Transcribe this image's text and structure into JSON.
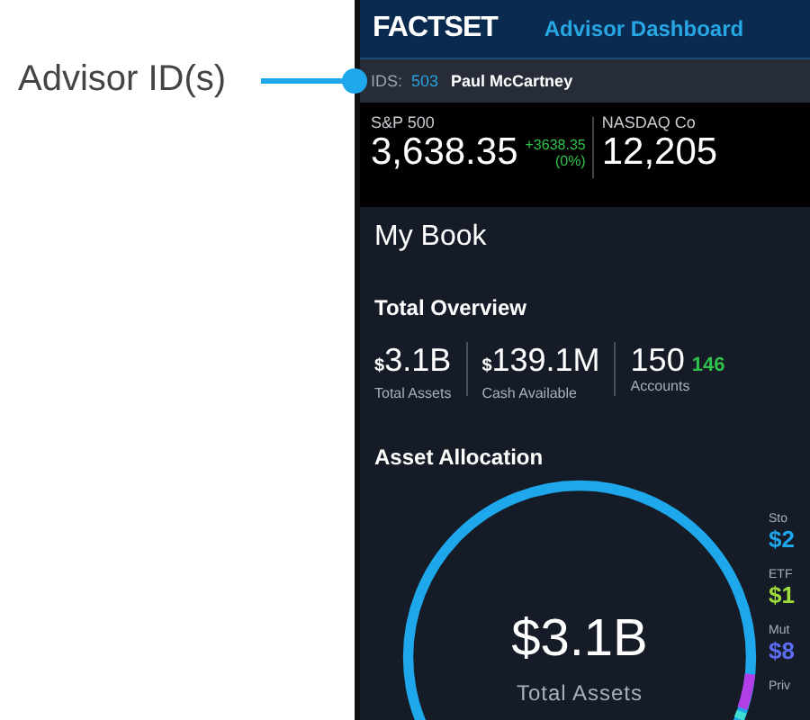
{
  "callout": {
    "label": "Advisor ID(s)"
  },
  "header": {
    "logo": "FACTSET",
    "title": "Advisor Dashboard"
  },
  "id_bar": {
    "prefix": "IDS:",
    "id": "503",
    "name": "Paul McCartney"
  },
  "tickers": [
    {
      "name": "S&P 500",
      "value": "3,638.35",
      "change": "+3638.35",
      "percent": "(0%)"
    },
    {
      "name": "NASDAQ Co",
      "value": "12,205"
    }
  ],
  "book": {
    "title": "My Book",
    "overview_title": "Total Overview",
    "stats": [
      {
        "currency": "$",
        "amount": "3.1B",
        "label": "Total Assets"
      },
      {
        "currency": "$",
        "amount": "139.1M",
        "label": "Cash Available"
      },
      {
        "amount": "150",
        "extra": "146",
        "label": "Accounts"
      }
    ],
    "allocation_title": "Asset Allocation",
    "donut": {
      "total": "$3.1B",
      "label": "Total Assets"
    },
    "legend": [
      {
        "name": "Sto",
        "value": "$2",
        "color": "#1ea7ea"
      },
      {
        "name": "ETF",
        "value": "$1",
        "color": "#9ddc3a"
      },
      {
        "name": "Mut",
        "value": "$8",
        "color": "#5b6cf2"
      },
      {
        "name": "Priv"
      }
    ]
  }
}
